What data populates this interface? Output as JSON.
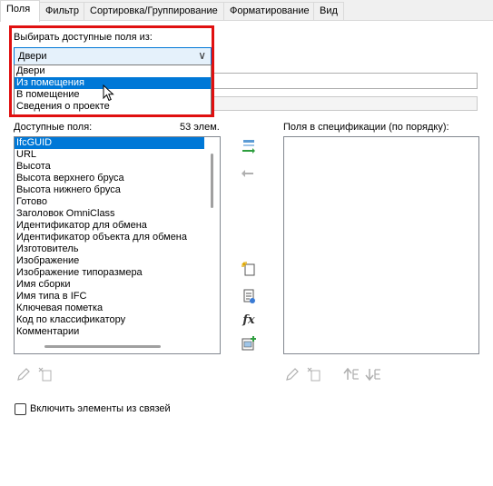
{
  "tabs": [
    {
      "label": "Поля"
    },
    {
      "label": "Фильтр"
    },
    {
      "label": "Сортировка/Группирование"
    },
    {
      "label": "Форматирование"
    },
    {
      "label": "Вид"
    }
  ],
  "select_from": {
    "label": "Выбирать доступные поля из:",
    "current": "Двери",
    "options": [
      "Двери",
      "Из помещения",
      "В помещение",
      "Сведения о проекте"
    ],
    "highlighted": "Из помещения"
  },
  "available": {
    "label": "Доступные поля:",
    "count": "53 элем.",
    "items": [
      "IfcGUID",
      "URL",
      "Высота",
      "Высота верхнего бруса",
      "Высота нижнего бруса",
      "Готово",
      "Заголовок OmniClass",
      "Идентификатор для обмена",
      "Идентификатор объекта для обмена",
      "Изготовитель",
      "Изображение",
      "Изображение типоразмера",
      "Имя сборки",
      "Имя типа в IFC",
      "Ключевая пометка",
      "Код по классификатору",
      "Комментарии"
    ],
    "selected": "IfcGUID"
  },
  "scheduled": {
    "label": "Поля в спецификации (по порядку):"
  },
  "include_links": {
    "label": "Включить элементы из связей",
    "checked": false
  },
  "colors": {
    "accent": "#0078d7",
    "highlight_box": "#e01010",
    "add_arrow": "#2e9e3e"
  }
}
